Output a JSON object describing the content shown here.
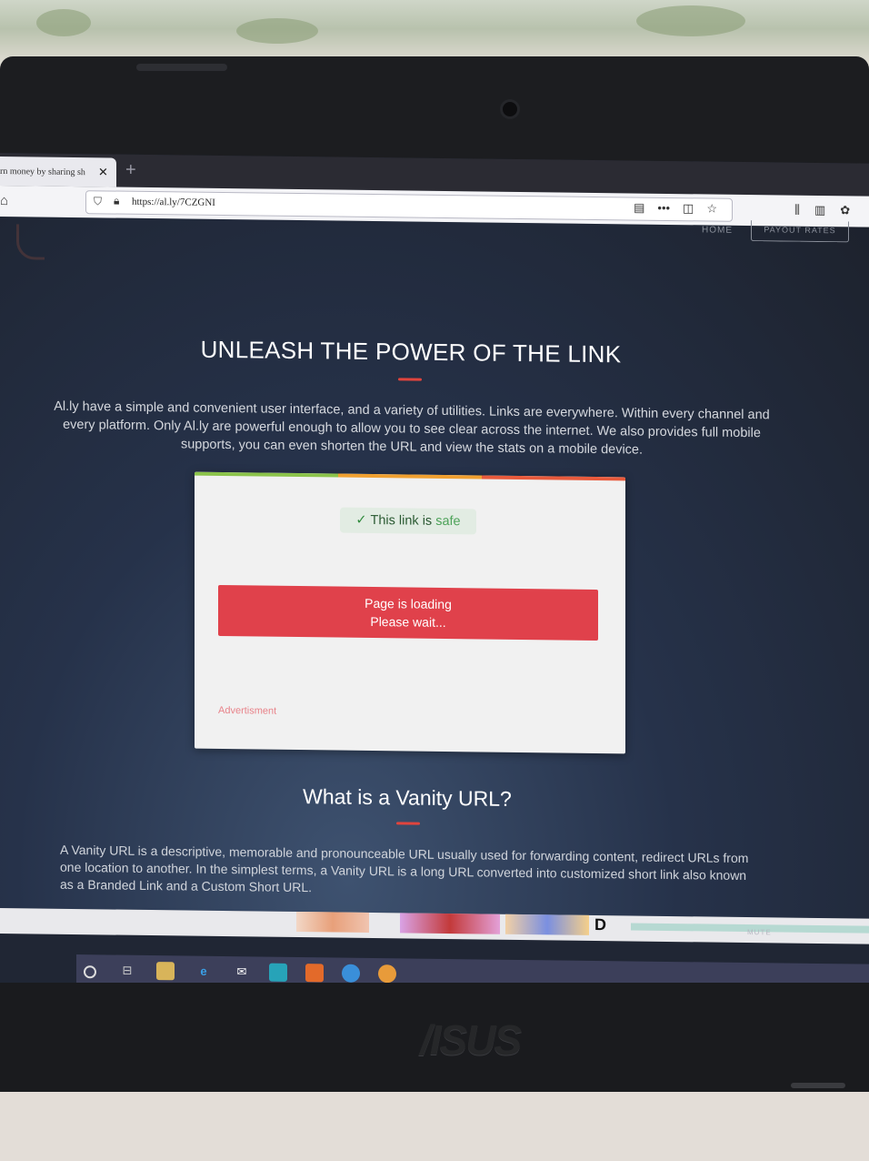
{
  "browser": {
    "tab_title": "rn money by sharing sh",
    "tab_close": "✕",
    "new_tab": "+",
    "url": "https://al.ly/7CZGNI"
  },
  "site_nav": {
    "home": "HOME",
    "payout_rates": "PAYOUT RATES"
  },
  "hero": {
    "title": "UNLEASH THE POWER OF THE LINK",
    "text": "Al.ly have a simple and convenient user interface, and a variety of utilities. Links are everywhere. Within every channel and every platform. Only Al.ly are powerful enough to allow you to see clear across the internet. We also provides full mobile supports, you can even shorten the URL and view the stats on a mobile device."
  },
  "card": {
    "safe_check": "✓",
    "safe_prefix": "This link is ",
    "safe_word": "safe",
    "loading_line1": "Page is loading",
    "loading_line2": "Please wait...",
    "ad_label": "Advertisment"
  },
  "vanity": {
    "title": "What is a Vanity URL?",
    "text": "A Vanity URL is a descriptive, memorable and pronounceable URL usually used for forwarding content, redirect URLs from one location to another. In the simplest terms, a Vanity URL is a long URL converted into customized short link also known as a Branded Link and a Custom Short URL."
  },
  "ad_strip": {
    "mute": "MUTE"
  },
  "laptop_brand": "/ISUS",
  "colors": {
    "accent_red": "#e0443d",
    "button_red": "#e0414b",
    "safe_green": "#4ea35a",
    "card_top": [
      "#8bc34a",
      "#f0a030",
      "#e85a3c"
    ]
  },
  "icons": {
    "home": "home-icon",
    "shield": "shield-icon",
    "lock": "lock-icon",
    "reader": "reader-view-icon",
    "more": "more-icon",
    "pocket": "pocket-icon",
    "bookmark": "bookmark-star-icon",
    "library": "library-icon",
    "sidebar": "sidebar-icon",
    "extension": "extension-icon"
  }
}
